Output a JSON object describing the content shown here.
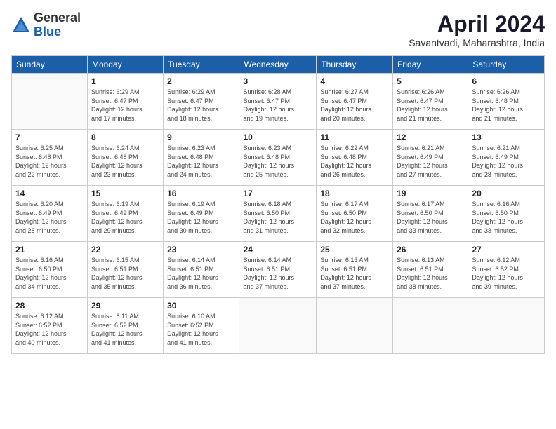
{
  "logo": {
    "general": "General",
    "blue": "Blue"
  },
  "title": "April 2024",
  "location": "Savantvadi, Maharashtra, India",
  "days_of_week": [
    "Sunday",
    "Monday",
    "Tuesday",
    "Wednesday",
    "Thursday",
    "Friday",
    "Saturday"
  ],
  "weeks": [
    [
      {
        "day": "",
        "sunrise": "",
        "sunset": "",
        "daylight": ""
      },
      {
        "day": "1",
        "sunrise": "Sunrise: 6:29 AM",
        "sunset": "Sunset: 6:47 PM",
        "daylight": "Daylight: 12 hours and 17 minutes."
      },
      {
        "day": "2",
        "sunrise": "Sunrise: 6:29 AM",
        "sunset": "Sunset: 6:47 PM",
        "daylight": "Daylight: 12 hours and 18 minutes."
      },
      {
        "day": "3",
        "sunrise": "Sunrise: 6:28 AM",
        "sunset": "Sunset: 6:47 PM",
        "daylight": "Daylight: 12 hours and 19 minutes."
      },
      {
        "day": "4",
        "sunrise": "Sunrise: 6:27 AM",
        "sunset": "Sunset: 6:47 PM",
        "daylight": "Daylight: 12 hours and 20 minutes."
      },
      {
        "day": "5",
        "sunrise": "Sunrise: 6:26 AM",
        "sunset": "Sunset: 6:47 PM",
        "daylight": "Daylight: 12 hours and 21 minutes."
      },
      {
        "day": "6",
        "sunrise": "Sunrise: 6:26 AM",
        "sunset": "Sunset: 6:48 PM",
        "daylight": "Daylight: 12 hours and 21 minutes."
      }
    ],
    [
      {
        "day": "7",
        "sunrise": "Sunrise: 6:25 AM",
        "sunset": "Sunset: 6:48 PM",
        "daylight": "Daylight: 12 hours and 22 minutes."
      },
      {
        "day": "8",
        "sunrise": "Sunrise: 6:24 AM",
        "sunset": "Sunset: 6:48 PM",
        "daylight": "Daylight: 12 hours and 23 minutes."
      },
      {
        "day": "9",
        "sunrise": "Sunrise: 6:23 AM",
        "sunset": "Sunset: 6:48 PM",
        "daylight": "Daylight: 12 hours and 24 minutes."
      },
      {
        "day": "10",
        "sunrise": "Sunrise: 6:23 AM",
        "sunset": "Sunset: 6:48 PM",
        "daylight": "Daylight: 12 hours and 25 minutes."
      },
      {
        "day": "11",
        "sunrise": "Sunrise: 6:22 AM",
        "sunset": "Sunset: 6:48 PM",
        "daylight": "Daylight: 12 hours and 26 minutes."
      },
      {
        "day": "12",
        "sunrise": "Sunrise: 6:21 AM",
        "sunset": "Sunset: 6:49 PM",
        "daylight": "Daylight: 12 hours and 27 minutes."
      },
      {
        "day": "13",
        "sunrise": "Sunrise: 6:21 AM",
        "sunset": "Sunset: 6:49 PM",
        "daylight": "Daylight: 12 hours and 28 minutes."
      }
    ],
    [
      {
        "day": "14",
        "sunrise": "Sunrise: 6:20 AM",
        "sunset": "Sunset: 6:49 PM",
        "daylight": "Daylight: 12 hours and 28 minutes."
      },
      {
        "day": "15",
        "sunrise": "Sunrise: 6:19 AM",
        "sunset": "Sunset: 6:49 PM",
        "daylight": "Daylight: 12 hours and 29 minutes."
      },
      {
        "day": "16",
        "sunrise": "Sunrise: 6:19 AM",
        "sunset": "Sunset: 6:49 PM",
        "daylight": "Daylight: 12 hours and 30 minutes."
      },
      {
        "day": "17",
        "sunrise": "Sunrise: 6:18 AM",
        "sunset": "Sunset: 6:50 PM",
        "daylight": "Daylight: 12 hours and 31 minutes."
      },
      {
        "day": "18",
        "sunrise": "Sunrise: 6:17 AM",
        "sunset": "Sunset: 6:50 PM",
        "daylight": "Daylight: 12 hours and 32 minutes."
      },
      {
        "day": "19",
        "sunrise": "Sunrise: 6:17 AM",
        "sunset": "Sunset: 6:50 PM",
        "daylight": "Daylight: 12 hours and 33 minutes."
      },
      {
        "day": "20",
        "sunrise": "Sunrise: 6:16 AM",
        "sunset": "Sunset: 6:50 PM",
        "daylight": "Daylight: 12 hours and 33 minutes."
      }
    ],
    [
      {
        "day": "21",
        "sunrise": "Sunrise: 6:16 AM",
        "sunset": "Sunset: 6:50 PM",
        "daylight": "Daylight: 12 hours and 34 minutes."
      },
      {
        "day": "22",
        "sunrise": "Sunrise: 6:15 AM",
        "sunset": "Sunset: 6:51 PM",
        "daylight": "Daylight: 12 hours and 35 minutes."
      },
      {
        "day": "23",
        "sunrise": "Sunrise: 6:14 AM",
        "sunset": "Sunset: 6:51 PM",
        "daylight": "Daylight: 12 hours and 36 minutes."
      },
      {
        "day": "24",
        "sunrise": "Sunrise: 6:14 AM",
        "sunset": "Sunset: 6:51 PM",
        "daylight": "Daylight: 12 hours and 37 minutes."
      },
      {
        "day": "25",
        "sunrise": "Sunrise: 6:13 AM",
        "sunset": "Sunset: 6:51 PM",
        "daylight": "Daylight: 12 hours and 37 minutes."
      },
      {
        "day": "26",
        "sunrise": "Sunrise: 6:13 AM",
        "sunset": "Sunset: 6:51 PM",
        "daylight": "Daylight: 12 hours and 38 minutes."
      },
      {
        "day": "27",
        "sunrise": "Sunrise: 6:12 AM",
        "sunset": "Sunset: 6:52 PM",
        "daylight": "Daylight: 12 hours and 39 minutes."
      }
    ],
    [
      {
        "day": "28",
        "sunrise": "Sunrise: 6:12 AM",
        "sunset": "Sunset: 6:52 PM",
        "daylight": "Daylight: 12 hours and 40 minutes."
      },
      {
        "day": "29",
        "sunrise": "Sunrise: 6:11 AM",
        "sunset": "Sunset: 6:52 PM",
        "daylight": "Daylight: 12 hours and 41 minutes."
      },
      {
        "day": "30",
        "sunrise": "Sunrise: 6:10 AM",
        "sunset": "Sunset: 6:52 PM",
        "daylight": "Daylight: 12 hours and 41 minutes."
      },
      {
        "day": "",
        "sunrise": "",
        "sunset": "",
        "daylight": ""
      },
      {
        "day": "",
        "sunrise": "",
        "sunset": "",
        "daylight": ""
      },
      {
        "day": "",
        "sunrise": "",
        "sunset": "",
        "daylight": ""
      },
      {
        "day": "",
        "sunrise": "",
        "sunset": "",
        "daylight": ""
      }
    ]
  ]
}
